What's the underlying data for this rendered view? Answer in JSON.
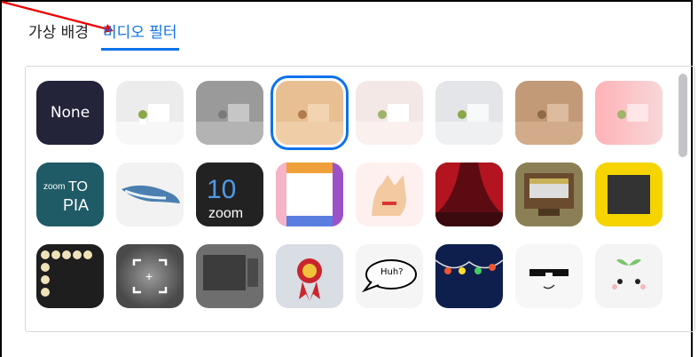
{
  "tabs": [
    {
      "label": "가상 배경",
      "active": false
    },
    {
      "label": "비디오 필터",
      "active": true
    }
  ],
  "accent_color": "#0e72ed",
  "tiles": [
    {
      "name": "none",
      "label": "None"
    },
    {
      "name": "room-white"
    },
    {
      "name": "room-gray"
    },
    {
      "name": "room-tan",
      "selected": true
    },
    {
      "name": "room-pink"
    },
    {
      "name": "room-lightgray"
    },
    {
      "name": "room-brown"
    },
    {
      "name": "room-rose"
    },
    {
      "name": "zoomtopia-logo",
      "label": "zoom TO PIA"
    },
    {
      "name": "whale"
    },
    {
      "name": "zoom-10",
      "label": "10 zoom"
    },
    {
      "name": "rainbow-frame"
    },
    {
      "name": "corgi-dog"
    },
    {
      "name": "theater-curtains"
    },
    {
      "name": "retro-tv"
    },
    {
      "name": "emoji-frame"
    },
    {
      "name": "lightbulb-frame"
    },
    {
      "name": "focus-frame"
    },
    {
      "name": "tv-frame"
    },
    {
      "name": "first-place-ribbon"
    },
    {
      "name": "speech-bubble",
      "label": "Huh?"
    },
    {
      "name": "string-lights"
    },
    {
      "name": "sunglasses"
    },
    {
      "name": "sprout-face"
    }
  ]
}
